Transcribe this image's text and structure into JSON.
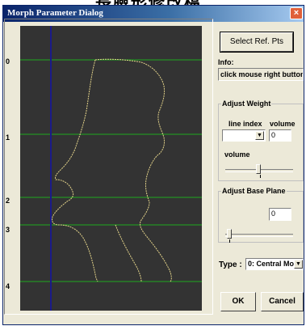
{
  "window": {
    "title": "Morph Parameter Dialog",
    "close_glyph": "×"
  },
  "canvas": {
    "background": "#333333",
    "line_color": "#1fa81f",
    "profile_color": "#e3d38a",
    "vertical_line_color": "#1a1a8a",
    "row_labels": [
      "0",
      "1",
      "2",
      "3",
      "4"
    ]
  },
  "controls": {
    "select_ref_label": "Select Ref. Pts",
    "info_label": "Info:",
    "info_text": "click mouse right button t",
    "adjust_weight": {
      "legend": "Adjust Weight",
      "line_index_label": "line index",
      "volume_header": "volume",
      "line_index_value": "",
      "volume_value": "0",
      "slider_label": "volume",
      "slider_level": 0.55
    },
    "adjust_base_plane": {
      "legend": "Adjust Base Plane",
      "value": "0",
      "slider_level": 0.0
    },
    "type_label": "Type :",
    "type_selected": "0: Central Mor",
    "ok_label": "OK",
    "cancel_label": "Cancel"
  }
}
